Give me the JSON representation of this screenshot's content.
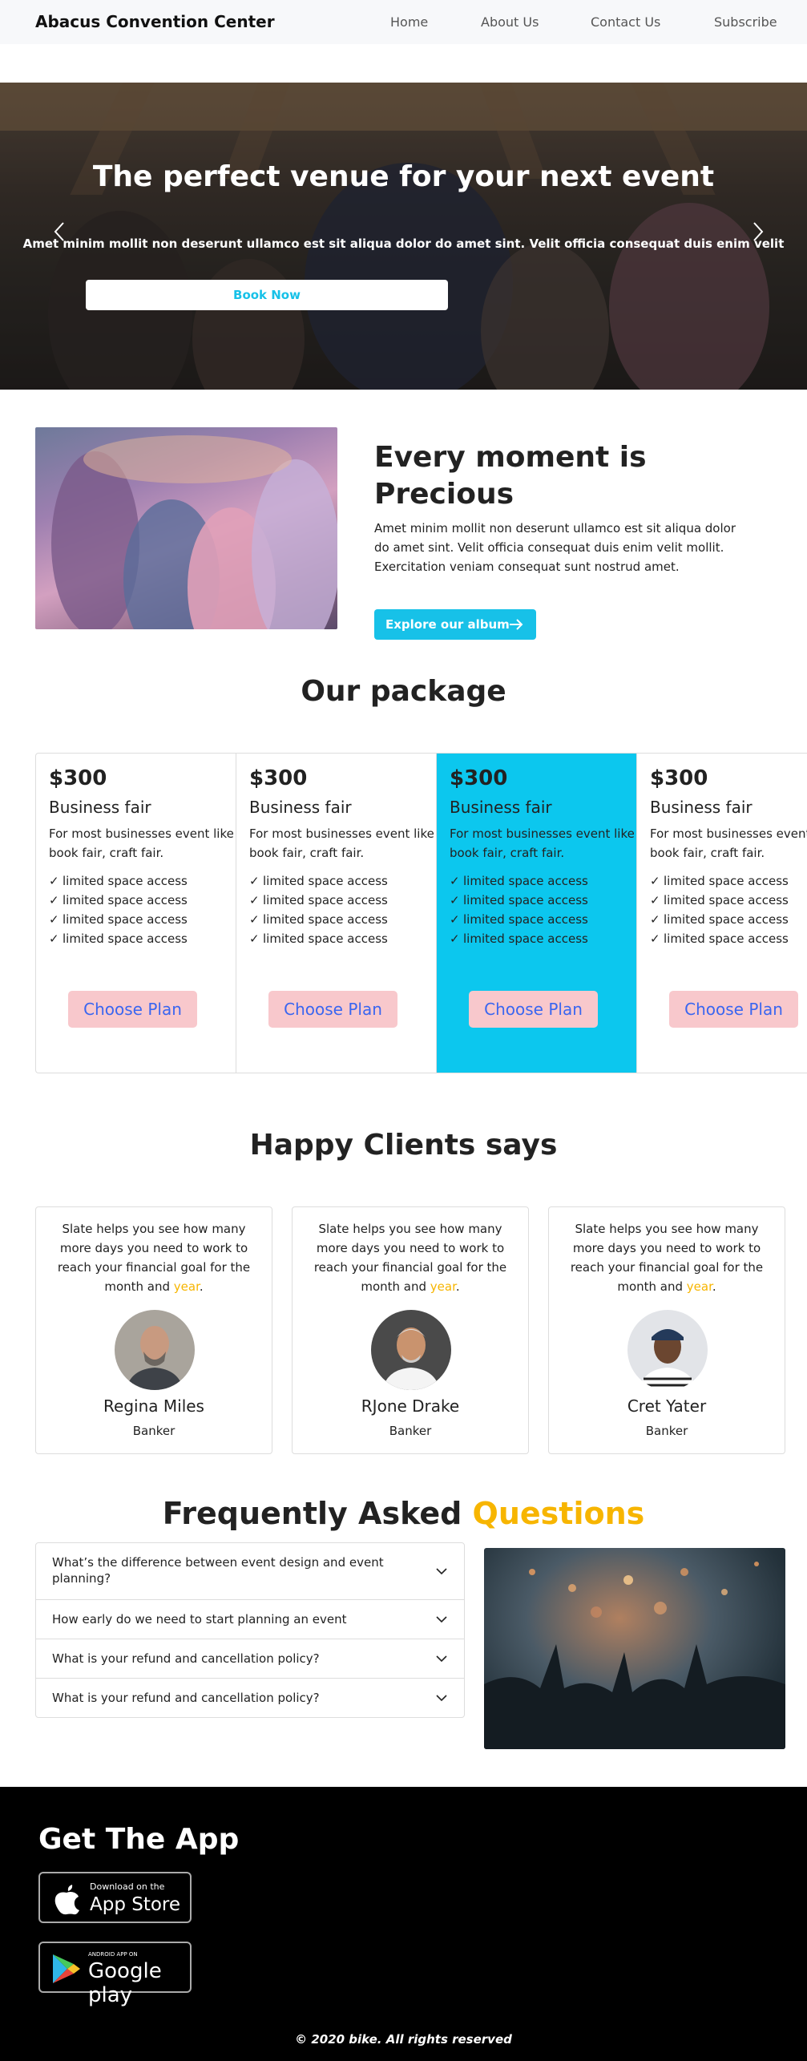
{
  "nav": {
    "brand": "Abacus Convention Center",
    "links": [
      "Home",
      "About Us",
      "Contact Us",
      "Subscribe"
    ]
  },
  "hero": {
    "title": "The perfect venue for your next event",
    "subtitle": "Amet minim mollit non deserunt ullamco est sit aliqua dolor do amet sint. Velit officia consequat duis enim velit",
    "button": "Book Now",
    "prev_icon": "chevron-left-icon",
    "next_icon": "chevron-right-icon"
  },
  "about": {
    "title": "Every moment is Precious",
    "text": "Amet minim mollit non deserunt ullamco est sit aliqua dolor do amet sint. Velit officia consequat duis enim velit mollit. Exercitation veniam consequat sunt nostrud amet.",
    "button": "Explore our album",
    "button_icon": "arrow-right-icon"
  },
  "packages": {
    "title": "Our package",
    "accent": "#0cc7ee",
    "items": [
      {
        "price": "$300",
        "name": "Business fair",
        "desc": "For most businesses event like book fair, craft fair.",
        "features": [
          "limited space access",
          "limited space access",
          "limited space access",
          "limited space access"
        ],
        "button": "Choose Plan",
        "active": false
      },
      {
        "price": "$300",
        "name": "Business fair",
        "desc": "For most businesses event like book fair, craft fair.",
        "features": [
          "limited space access",
          "limited space access",
          "limited space access",
          "limited space access"
        ],
        "button": "Choose Plan",
        "active": false
      },
      {
        "price": "$300",
        "name": "Business fair",
        "desc": "For most businesses event like book fair, craft fair.",
        "features": [
          "limited space access",
          "limited space access",
          "limited space access",
          "limited space access"
        ],
        "button": "Choose Plan",
        "active": true
      },
      {
        "price": "$300",
        "name": "Business fair",
        "desc": "For most businesses event like book fair, craft fair.",
        "features": [
          "limited space access",
          "limited space access",
          "limited space access",
          "limited space access"
        ],
        "button": "Choose Plan",
        "active": false
      }
    ]
  },
  "clients": {
    "title": "Happy Clients says",
    "items": [
      {
        "quote": "Slate helps you see how many more days you need to work to reach your financial goal for the month and",
        "highlight": "year",
        "name": "Regina Miles",
        "role": "Banker"
      },
      {
        "quote": "Slate helps you see how many more days you need to work to reach your financial goal for the month and",
        "highlight": "year",
        "name": "RJone Drake",
        "role": "Banker"
      },
      {
        "quote": "Slate helps you see how many more days you need to work to reach your financial goal for the month and",
        "highlight": "year",
        "name": "Cret Yater",
        "role": "Banker"
      }
    ]
  },
  "faq": {
    "title_main": "Frequently Asked",
    "title_highlight": "Questions",
    "highlight_color": "#f7b500",
    "items": [
      "What’s the difference between event design and event planning?",
      "How early do we need to start planning an event",
      "What is your refund and cancellation policy?",
      "What is your refund and cancellation policy?"
    ]
  },
  "footer": {
    "get_app": "Get The App",
    "app_store_small": "Download on the",
    "app_store_big": "App Store",
    "google_small": "ANDROID APP ON",
    "google_big": "Google play",
    "copyright": "© 2020 bike. All rights reserved"
  }
}
